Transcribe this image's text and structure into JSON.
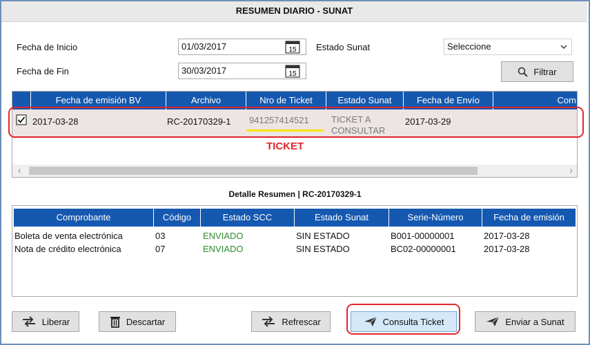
{
  "window": {
    "title": "RESUMEN DIARIO - SUNAT"
  },
  "filters": {
    "fecha_inicio_label": "Fecha de Inicio",
    "fecha_inicio_value": "01/03/2017",
    "fecha_fin_label": "Fecha de Fin",
    "fecha_fin_value": "30/03/2017",
    "estado_label": "Estado Sunat",
    "estado_value": "Seleccione",
    "filtrar_label": "Filtrar",
    "calendar_day": "15"
  },
  "grid1": {
    "columns": [
      "Fecha de emisión BV",
      "Archivo",
      "Nro de Ticket",
      "Estado Sunat",
      "Fecha de Envío",
      "Com"
    ],
    "row": {
      "fecha_emision": "2017-03-28",
      "archivo": "RC-20170329-1",
      "ticket": "941257414521",
      "estado_line1": "TICKET A",
      "estado_line2": "CONSULTAR",
      "fecha_envio": "2017-03-29"
    },
    "annotation": "TICKET",
    "scroll_left": "‹",
    "scroll_right": "›"
  },
  "detalle": {
    "title": "Detalle Resumen | RC-20170329-1",
    "columns": [
      "Comprobante",
      "Código",
      "Estado SCC",
      "Estado Sunat",
      "Serie-Número",
      "Fecha de emisión"
    ],
    "rows": [
      {
        "comprobante": "Boleta de venta electrónica",
        "codigo": "03",
        "estado_scc": "ENVIADO",
        "estado_sunat": "SIN ESTADO",
        "serie": "B001-00000001",
        "fecha": "2017-03-28"
      },
      {
        "comprobante": "Nota de crédito electrónica",
        "codigo": "07",
        "estado_scc": "ENVIADO",
        "estado_sunat": "SIN ESTADO",
        "serie": "BC02-00000001",
        "fecha": "2017-03-28"
      }
    ]
  },
  "buttons": {
    "liberar": "Liberar",
    "descartar": "Descartar",
    "refrescar": "Refrescar",
    "consulta_ticket": "Consulta Ticket",
    "enviar_sunat": "Enviar a Sunat"
  },
  "colors": {
    "header_blue": "#1558b0",
    "enviado_green": "#2e8b2e",
    "annotation_red": "#e0262a"
  }
}
